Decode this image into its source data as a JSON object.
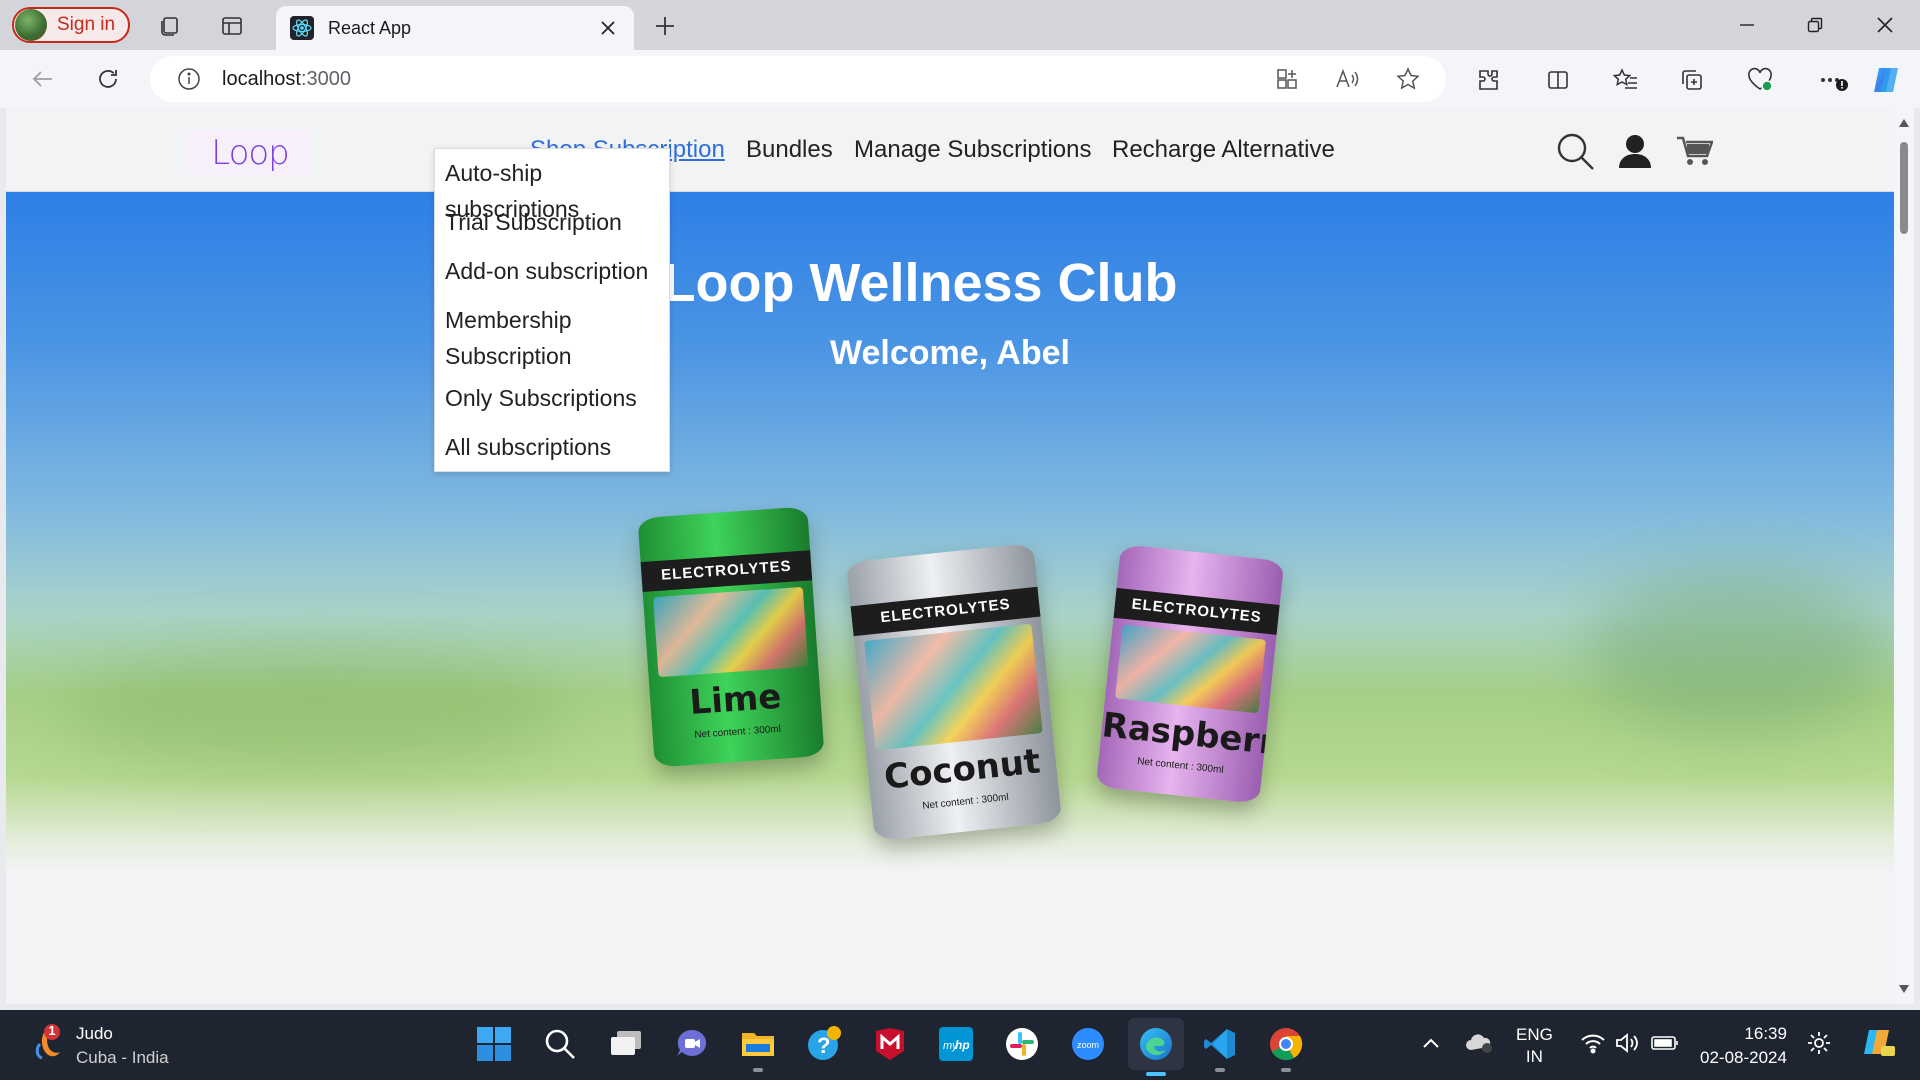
{
  "browser": {
    "profile_label": "Sign in",
    "tab_title": "React App",
    "url_host": "localhost",
    "url_port": ":3000"
  },
  "site": {
    "logo_text": "Loop",
    "nav": [
      "Shop Subscription",
      "Bundles",
      "Manage Subscriptions",
      "Recharge Alternative"
    ],
    "dropdown": [
      "Auto-ship subscriptions",
      "Trial Subscription",
      "Add-on subscription",
      "Membership Subscription",
      "Only Subscriptions",
      "All subscriptions"
    ],
    "hero_title": "Loop Wellness Club",
    "hero_title_visible": "Wellness Club",
    "hero_subtitle": "Welcome, Abel",
    "cans": [
      {
        "band": "ELECTROLYTES",
        "name": "Lime",
        "net": "Net content : 300ml",
        "color": "#34b14a"
      },
      {
        "band": "ELECTROLYTES",
        "name": "Coconut",
        "net": "Net content : 300ml",
        "color": "#c9cdd3"
      },
      {
        "band": "ELECTROLYTES",
        "name": "Raspberry",
        "net": "Net content : 300ml",
        "color": "#c98fd6"
      }
    ]
  },
  "taskbar": {
    "weather_badge": "1",
    "weather_title": "Judo",
    "weather_sub": "Cuba - India",
    "lang_top": "ENG",
    "lang_bottom": "IN",
    "time": "16:39",
    "date": "02-08-2024"
  },
  "colors": {
    "accent_link": "#2f6fdc",
    "logo_purple": "#7b3fe4",
    "signin_red": "#c42b1c",
    "taskbar_bg": "#1f2530"
  }
}
